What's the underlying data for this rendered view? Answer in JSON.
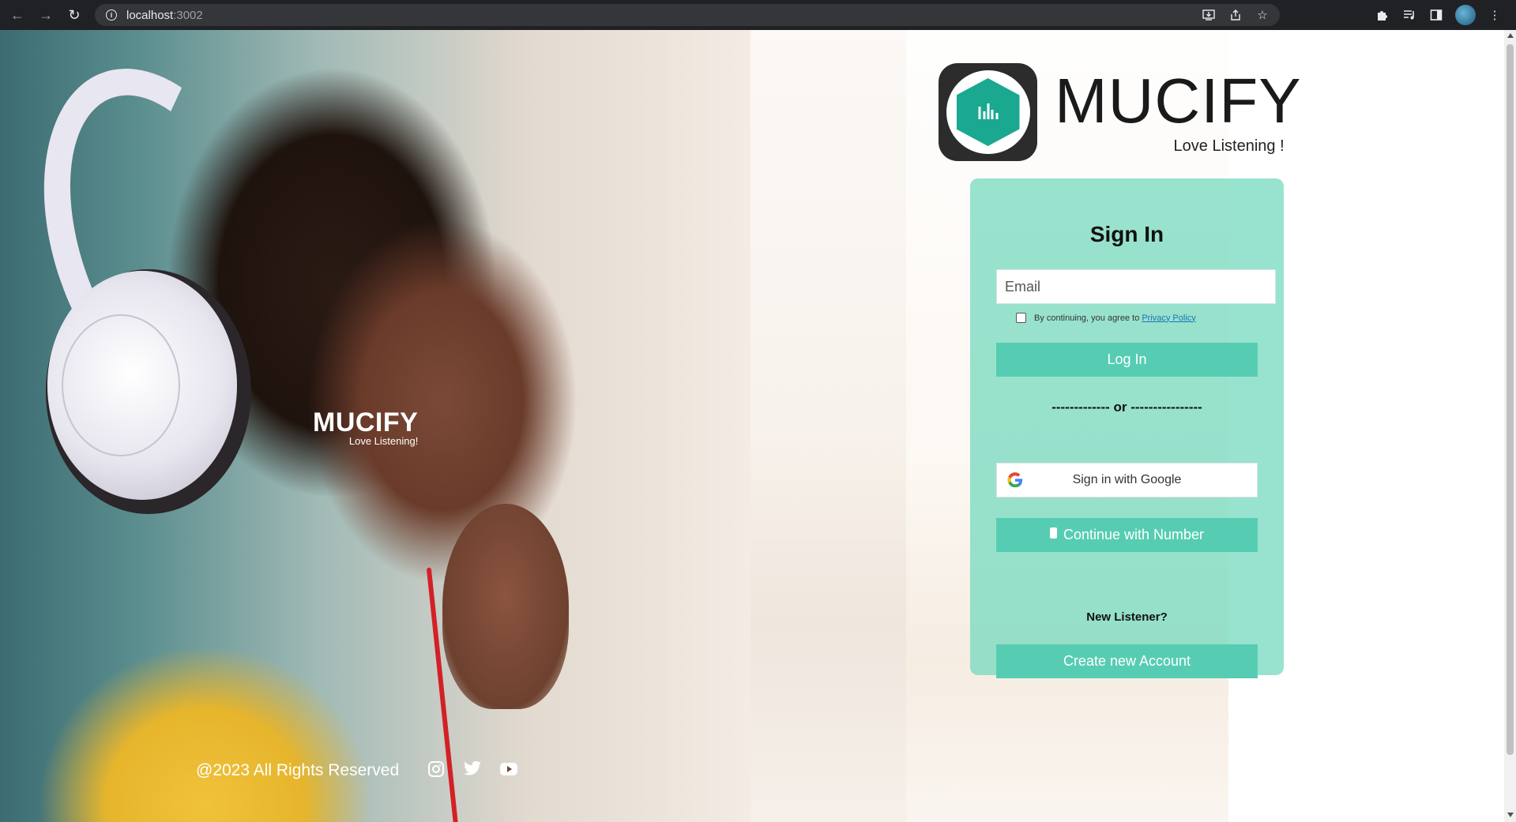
{
  "browser": {
    "url_host": "localhost",
    "url_port": ":3002"
  },
  "hero": {
    "logo_name": "MUCIFY",
    "logo_tagline": "Love Listening!",
    "footer_text": "@2023 All Rights Reserved",
    "social_icons": [
      "instagram-icon",
      "twitter-icon",
      "youtube-icon"
    ]
  },
  "brand": {
    "name": "MUCIFY",
    "tagline": "Love Listening !"
  },
  "signin": {
    "title": "Sign In",
    "email_placeholder": "Email",
    "consent_text": "By continuing, you agree to",
    "privacy_link": "Privacy Policy",
    "login_label": "Log In",
    "divider": "------------- or ----------------",
    "google_label": "Sign in with Google",
    "number_label": "Continue with Number",
    "new_listener": "New Listener?",
    "create_label": "Create new Account"
  },
  "colors": {
    "accent": "#56cdb2",
    "card": "#70d8bd",
    "brand_hex": "#1aa891"
  }
}
